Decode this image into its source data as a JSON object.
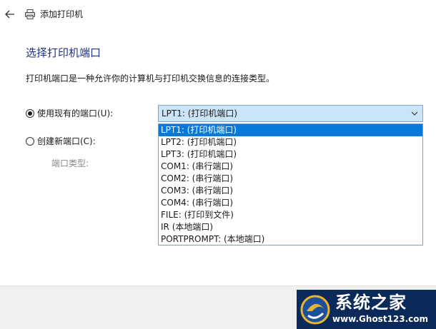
{
  "window": {
    "title": "添加打印机"
  },
  "page": {
    "heading": "选择打印机端口",
    "description": "打印机端口是一种允许你的计算机与打印机交换信息的连接类型。"
  },
  "options": {
    "use_existing_label": "使用现有的端口(U):",
    "create_new_label": "创建新端口(C):",
    "port_type_label": "端口类型:"
  },
  "port_select": {
    "selected_value": "LPT1: (打印机端口)",
    "options": [
      "LPT1: (打印机端口)",
      "LPT2: (打印机端口)",
      "LPT3: (打印机端口)",
      "COM1: (串行端口)",
      "COM2: (串行端口)",
      "COM3: (串行端口)",
      "COM4: (串行端口)",
      "FILE: (打印到文件)",
      "IR (本地端口)",
      "PORTPROMPT: (本地端口)"
    ]
  },
  "watermark": {
    "title": "系统之家",
    "url": "www.Ghost123.com"
  },
  "colors": {
    "heading": "#1e3287",
    "selection": "#0a78d7",
    "select_bg": "#cce4f7"
  }
}
